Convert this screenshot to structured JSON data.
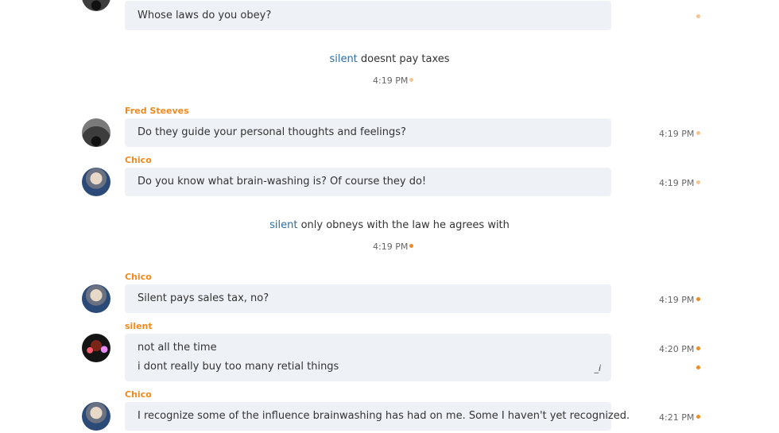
{
  "messages": [
    {
      "author": "",
      "lines": [
        "Whose laws do you obey?"
      ],
      "time": ""
    },
    {
      "author": "Fred Steeves",
      "lines": [
        "Do they guide your personal thoughts and feelings?"
      ],
      "time": "4:19 PM"
    },
    {
      "author": "Chico",
      "lines": [
        "Do you know what brain-washing is?  Of course they do!"
      ],
      "time": "4:19 PM"
    },
    {
      "author": "Chico",
      "lines": [
        "Silent pays sales tax, no?"
      ],
      "time": "4:19 PM"
    },
    {
      "author": "silent",
      "lines": [
        "not all the time",
        "i dont really buy too many retial things"
      ],
      "time": "4:20 PM"
    },
    {
      "author": "Chico",
      "lines": [
        "I recognize some of the influence brainwashing has had on me.  Some I haven't yet recognized."
      ],
      "time": "4:21 PM"
    }
  ],
  "system": [
    {
      "user": "silent",
      "text": " doesnt pay taxes",
      "time": "4:19 PM"
    },
    {
      "user": "silent",
      "text": " only obneys with the law he agrees with",
      "time": "4:19 PM"
    }
  ],
  "edit_marker": "_i",
  "colors": {
    "author": "#ef8a1f",
    "system_user": "#2b6ea3",
    "bubble": "#eef1f6",
    "status_pale": "#f6c48f",
    "status_solid": "#f08a24"
  }
}
